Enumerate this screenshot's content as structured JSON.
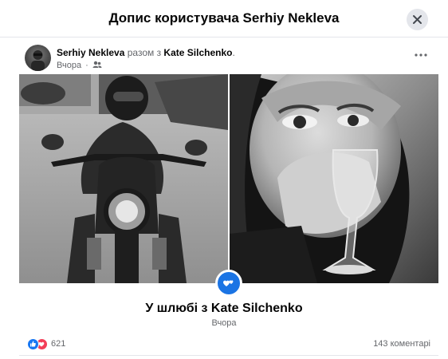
{
  "modal": {
    "title": "Допис користувача Serhiy Nekleva",
    "close_icon": "close-icon"
  },
  "post": {
    "author": "Serhiy Nekleva",
    "with_text": "разом з",
    "tagged": "Kate Silchenko",
    "period": ".",
    "time": "Вчора",
    "audience_icon": "friends-icon",
    "more_icon": "more-dots-icon"
  },
  "life_event": {
    "icon": "hearts-icon",
    "title": "У шлюбі з Kate Silchenko",
    "date": "Вчора"
  },
  "footer": {
    "reaction_icons": [
      "like-icon",
      "love-icon"
    ],
    "reactions_count": "621",
    "comments": "143 коментарі"
  },
  "colors": {
    "accent": "#1b74e4",
    "like": "#1877f2",
    "love": "#f33e58",
    "muted_text": "#65676b"
  }
}
